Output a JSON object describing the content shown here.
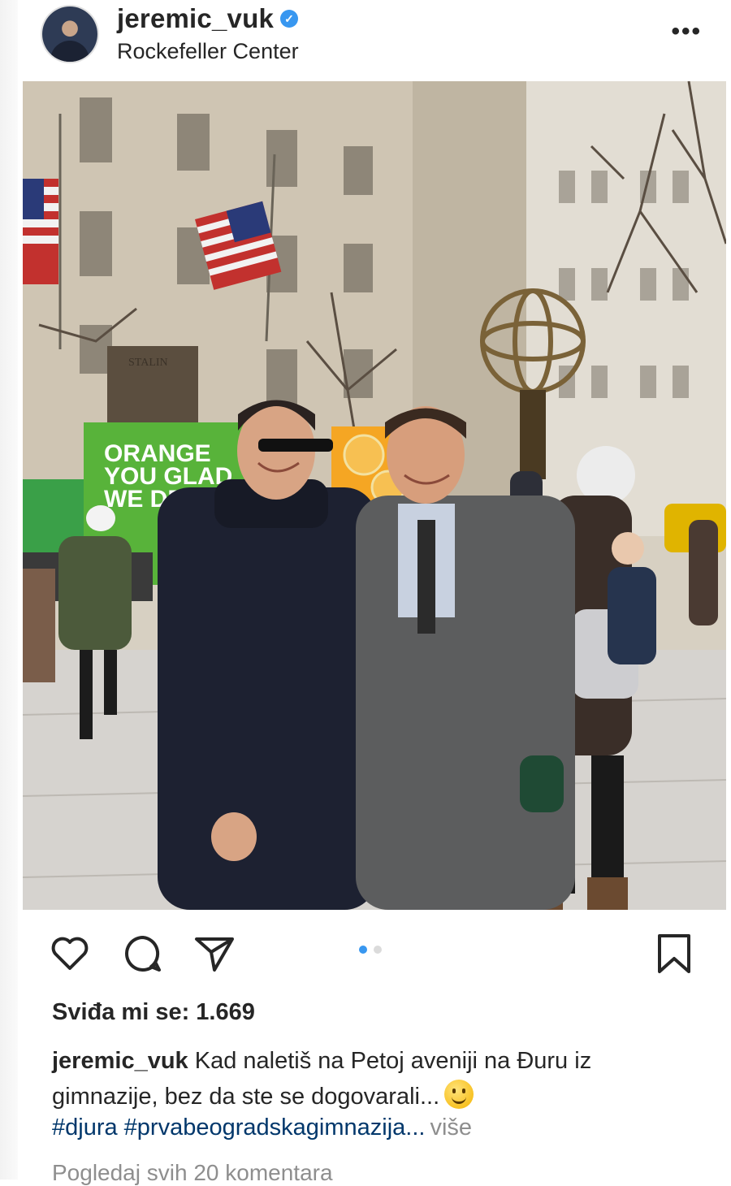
{
  "post": {
    "username": "jeremic_vuk",
    "location": "Rockefeller Center",
    "verified": true,
    "photo_truck_text": "ORANGE\nYOU GLAD\nWE DELIV",
    "photo_building_text": "STALIN",
    "carousel": {
      "total": 2,
      "active": 1
    },
    "likes_text": "Sviđa mi se: 1.669",
    "caption_user": "jeremic_vuk",
    "caption_text": "Kad naletiš na Petoj aveniji na Đuru iz gimnazije, bez da ste se dogovarali...",
    "hashtags": "#djura #prvabeogradskagimnazija...",
    "more_label": "više",
    "comments_link": "Pogledaj svih 20 komentara"
  },
  "icons": {
    "like": "heart-icon",
    "comment": "comment-icon",
    "share": "send-icon",
    "save": "bookmark-icon",
    "more": "more-dots-icon",
    "verified": "verified-badge-icon",
    "emoji": "smiling-face-emoji"
  },
  "colors": {
    "text": "#262626",
    "link": "#00376b",
    "muted": "#8e8e8e",
    "accent": "#3897f0"
  }
}
